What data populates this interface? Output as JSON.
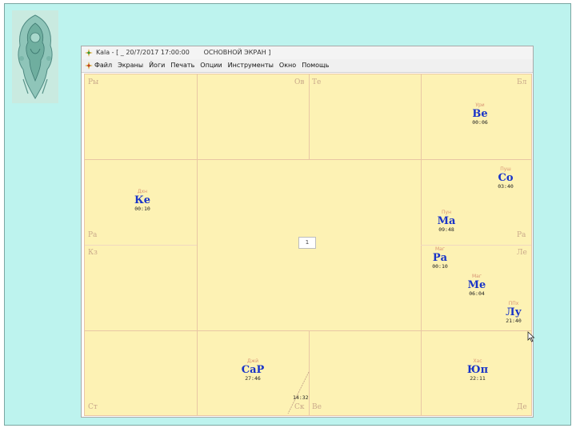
{
  "window": {
    "title": "Kala - [ _ 20/7/2017 17:00:00       ОСНОВНОЙ ЭКРАН ]"
  },
  "menu": {
    "items": [
      "Файл",
      "Экраны",
      "Йоги",
      "Печать",
      "Опции",
      "Инструменты",
      "Окно",
      "Помощь"
    ]
  },
  "houses": {
    "r1c1": "Ры",
    "r1c2": "Ов",
    "r1c3": "Те",
    "r1c4": "Бл",
    "r2c1_bottom": "Ра",
    "r2c1_top": "Ра",
    "r2c4_bottom": "Ра",
    "r3c1": "Кз",
    "r3c4": "Ле",
    "r4c1": "Ст",
    "r4c2": "Ск",
    "r4c3": "Ве",
    "r4c4": "Де"
  },
  "planets": [
    {
      "id": "ve",
      "nakshatra": "Ури",
      "name": "Ве",
      "degree": "00:06"
    },
    {
      "id": "so",
      "nakshatra": "Пуш",
      "name": "Со",
      "degree": "03:40"
    },
    {
      "id": "ma",
      "nakshatra": "Пун",
      "name": "Ма",
      "degree": "09:48"
    },
    {
      "id": "ra",
      "nakshatra": "Маг",
      "name": "Ра",
      "degree": "00:10"
    },
    {
      "id": "me",
      "nakshatra": "Маг",
      "name": "Ме",
      "degree": "06:04"
    },
    {
      "id": "lu",
      "nakshatra": "ППх",
      "name": "Лу",
      "degree": "21:40"
    },
    {
      "id": "ke",
      "nakshatra": "Дхн",
      "name": "Ке",
      "degree": "00:10"
    },
    {
      "id": "sar",
      "nakshatra": "Джй",
      "name": "СаР",
      "degree": "27:46"
    },
    {
      "id": "yu",
      "nakshatra": "Хас",
      "name": "Юп",
      "degree": "22:11"
    }
  ],
  "extra_time": "14:32",
  "center_box": "1",
  "icons": {
    "title": "kala-app-icon",
    "ornament": "ganesha-ornament",
    "cursor": "mouse-pointer-icon"
  },
  "colors": {
    "slide_bg": "#bdf3ee",
    "chart_bg": "#fdf2b4",
    "grid": "#e9c6a4",
    "planet": "#1934c8",
    "nakshatra": "#d89474"
  }
}
